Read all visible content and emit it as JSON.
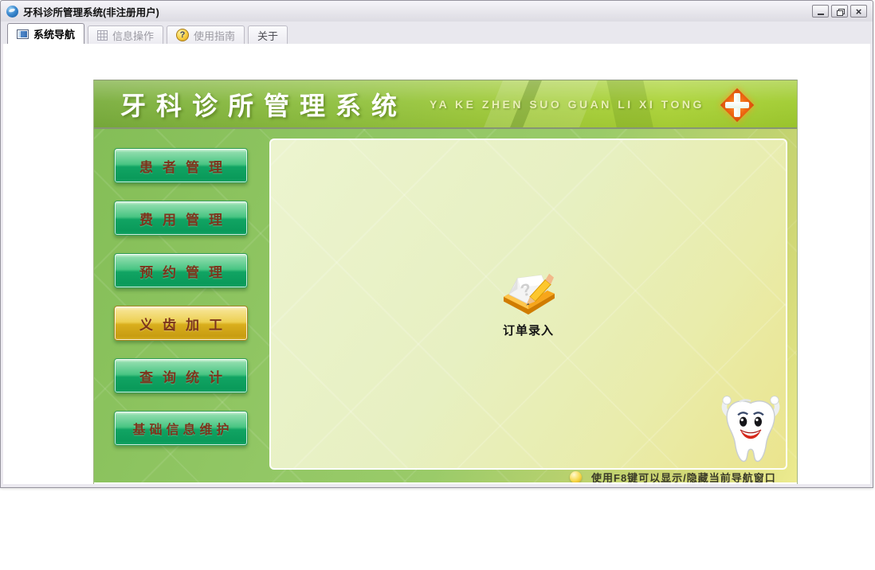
{
  "window": {
    "title": "牙科诊所管理系统(非注册用户)",
    "app_icon": "app-logo-icon",
    "controls": [
      "minimize-icon",
      "restore-icon",
      "close-icon"
    ]
  },
  "icons": {
    "close_glyph": "×",
    "help_glyph": "?",
    "paper_question": "?"
  },
  "tabs": [
    {
      "label": "系统导航",
      "icon": "navigation-window-icon",
      "state": "active"
    },
    {
      "label": "信息操作",
      "icon": "grid-icon",
      "state": "dimmed"
    },
    {
      "label": "使用指南",
      "icon": "help-question-icon",
      "state": "dimmed"
    },
    {
      "label": "关于",
      "icon": "",
      "state": "normal"
    }
  ],
  "banner": {
    "title": "牙科诊所管理系统",
    "subtitle": "YA KE ZHEN SUO GUAN LI XI TONG",
    "icon": "medical-cross-icon"
  },
  "sidebar": {
    "buttons": [
      {
        "label": "患者管理",
        "state": "normal"
      },
      {
        "label": "费用管理",
        "state": "normal"
      },
      {
        "label": "预约管理",
        "state": "normal"
      },
      {
        "label": "义齿加工",
        "state": "highlighted"
      },
      {
        "label": "查询统计",
        "state": "normal"
      },
      {
        "label": "基础信息维护",
        "state": "normal"
      }
    ]
  },
  "workspace": {
    "shortcut": {
      "label": "订单录入",
      "icon": "order-notebook-pencil-icon"
    },
    "mascot": "tooth-mascot"
  },
  "status_hint": {
    "icon": "yellow-sphere-icon",
    "text": "使用F8键可以显示/隐藏当前导航窗口"
  },
  "colors": {
    "banner_green_left": "#79ad3c",
    "banner_green_right": "#a8d236",
    "body_green": "#92c765",
    "panel_cream": "#e9f0c2",
    "panel_yellow": "#ebe48d",
    "button_green": "#11a463",
    "button_gold": "#d9ae1d",
    "button_text": "#7c341c",
    "cross_orange": "#ef6a12",
    "banner_text": "#ffffff",
    "banner_subtext": "#e9efb6"
  }
}
